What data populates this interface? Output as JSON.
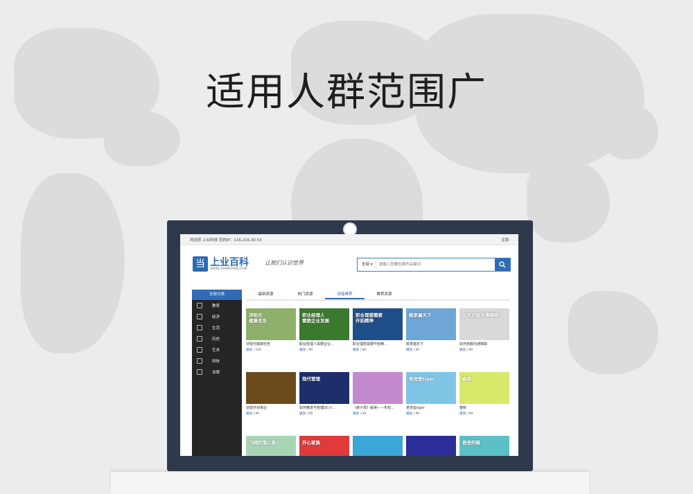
{
  "headline": "适用人群范围广",
  "site": {
    "welcome": "欢迎您 上业科技  您的IP：116.216.30.53",
    "logout": "注销",
    "logo_char": "当",
    "logo_title": "上业百科",
    "logo_domain": "BAIKE.SHANGYEKJ.COM",
    "slogan": "让我们认识世界",
    "search": {
      "category": "全部",
      "placeholder": "请输入您要检索的关键词"
    }
  },
  "sidebar": {
    "header": "全部分类",
    "items": [
      {
        "label": "教育"
      },
      {
        "label": "经济"
      },
      {
        "label": "生活"
      },
      {
        "label": "历史"
      },
      {
        "label": "艺术"
      },
      {
        "label": "科技"
      },
      {
        "label": "法律"
      }
    ]
  },
  "tabs": [
    {
      "label": "最新资源"
    },
    {
      "label": "热门资源"
    },
    {
      "label": "读者推荐"
    },
    {
      "label": "推荐资源"
    }
  ],
  "meta_label": "播放",
  "cards": [
    {
      "title": "洪昭光健康忠告",
      "plays": "100",
      "thumb_text": "洪昭光\n健康忠告",
      "color": "#8fb06a"
    },
    {
      "title": "职业经理人需要企业...",
      "plays": "99",
      "thumb_text": "职业经理人\n需要企业发展",
      "color": "#3b7a2e"
    },
    {
      "title": "职业理想需要开拓精...",
      "plays": "99",
      "thumb_text": "职业理想需要\n开拓精神",
      "color": "#1f4f8a"
    },
    {
      "title": "桃李遍天下",
      "plays": "99",
      "thumb_text": "桃李遍天下",
      "color": "#6fa6d8"
    },
    {
      "title": "如何克服沟通障碍",
      "plays": "99",
      "thumb_text": "如何克服沟通障碍",
      "color": "#d9d9d9"
    },
    {
      "title": "创造开创事业",
      "plays": "99",
      "thumb_text": "",
      "color": "#6b4a1c"
    },
    {
      "title": "如何推进与管理QC小...",
      "plays": "99",
      "thumb_text": "现代管理",
      "color": "#1d2f6b"
    },
    {
      "title": "《弟子规》解读——冬初...",
      "plays": "99",
      "thumb_text": "",
      "color": "#c48ad0"
    },
    {
      "title": "老虎是tiger",
      "plays": "99",
      "thumb_text": "老虎是tiger",
      "color": "#7fc5e6"
    },
    {
      "title": "春晓",
      "plays": "99",
      "thumb_text": "春晓",
      "color": "#d8e86b"
    },
    {
      "title": "",
      "plays": "",
      "thumb_text": "飞翔的蒲公英",
      "color": "#a8d6b4"
    },
    {
      "title": "",
      "plays": "",
      "thumb_text": "开心家族",
      "color": "#e03a3a"
    },
    {
      "title": "",
      "plays": "",
      "thumb_text": "",
      "color": "#3aa7d8"
    },
    {
      "title": "",
      "plays": "",
      "thumb_text": "",
      "color": "#2a2d9a"
    },
    {
      "title": "",
      "plays": "",
      "thumb_text": "爸爸的鞋",
      "color": "#5bc0c8"
    }
  ]
}
